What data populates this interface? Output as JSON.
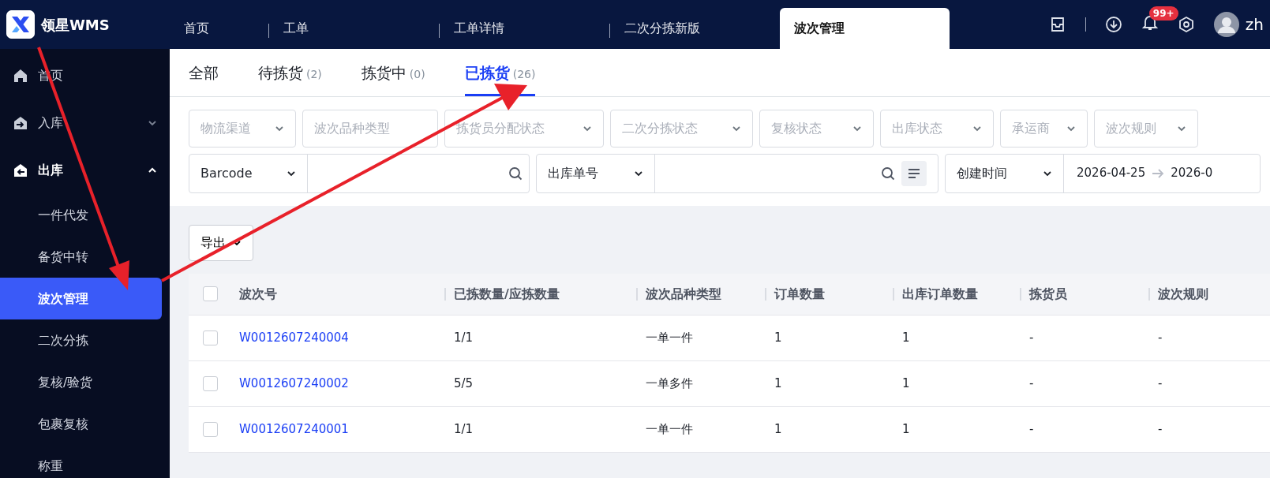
{
  "app": {
    "name": "领星WMS"
  },
  "top_tabs": [
    {
      "label": "首页",
      "selected": false
    },
    {
      "label": "工单",
      "selected": false
    },
    {
      "label": "工单详情",
      "selected": false
    },
    {
      "label": "二次分拣新版",
      "selected": false
    },
    {
      "label": "波次管理",
      "selected": true
    }
  ],
  "notifications": {
    "badge": "99+"
  },
  "user": {
    "name": "zh"
  },
  "sidebar": {
    "items": [
      {
        "label": "首页"
      },
      {
        "label": "入库",
        "expanded": false
      },
      {
        "label": "出库",
        "expanded": true,
        "children": [
          {
            "label": "一件代发",
            "selected": false
          },
          {
            "label": "备货中转",
            "selected": false
          },
          {
            "label": "波次管理",
            "selected": true
          },
          {
            "label": "二次分拣",
            "selected": false
          },
          {
            "label": "复核/验货",
            "selected": false
          },
          {
            "label": "包裹复核",
            "selected": false
          },
          {
            "label": "称重",
            "selected": false
          }
        ]
      }
    ]
  },
  "status_tabs": [
    {
      "label": "全部",
      "selected": false
    },
    {
      "label": "待拣货",
      "count": "(2)",
      "selected": false
    },
    {
      "label": "拣货中",
      "count": "(0)",
      "selected": false
    },
    {
      "label": "已拣货",
      "count": "(26)",
      "selected": true
    }
  ],
  "filters": [
    {
      "placeholder": "物流渠道",
      "kind": "select"
    },
    {
      "placeholder": "波次品种类型",
      "kind": "input"
    },
    {
      "placeholder": "拣货员分配状态",
      "kind": "select"
    },
    {
      "placeholder": "二次分拣状态",
      "kind": "select"
    },
    {
      "placeholder": "复核状态",
      "kind": "select"
    },
    {
      "placeholder": "出库状态",
      "kind": "select"
    },
    {
      "placeholder": "承运商",
      "kind": "select"
    },
    {
      "placeholder": "波次规则",
      "kind": "select"
    }
  ],
  "searches": [
    {
      "kind": "search",
      "field": "Barcode"
    },
    {
      "kind": "search-multi",
      "field": "出库单号"
    },
    {
      "kind": "date-range",
      "field": "创建时间",
      "start": "2026-04-25",
      "end": "2026-0"
    }
  ],
  "export_button": {
    "label": "导出"
  },
  "table": {
    "select_all": {
      "checked": false
    },
    "columns": [
      "波次号",
      "已拣数量/应拣数量",
      "波次品种类型",
      "订单数量",
      "出库订单数量",
      "拣货员",
      "波次规则"
    ],
    "rows": [
      {
        "checked": false,
        "cells": [
          "W0012607240004",
          "1/1",
          "一单一件",
          "1",
          "1",
          "-",
          "-"
        ]
      },
      {
        "checked": false,
        "cells": [
          "W0012607240002",
          "5/5",
          "一单多件",
          "1",
          "1",
          "-",
          "-"
        ]
      },
      {
        "checked": false,
        "cells": [
          "W0012607240001",
          "1/1",
          "一单一件",
          "1",
          "1",
          "-",
          "-"
        ]
      }
    ]
  }
}
